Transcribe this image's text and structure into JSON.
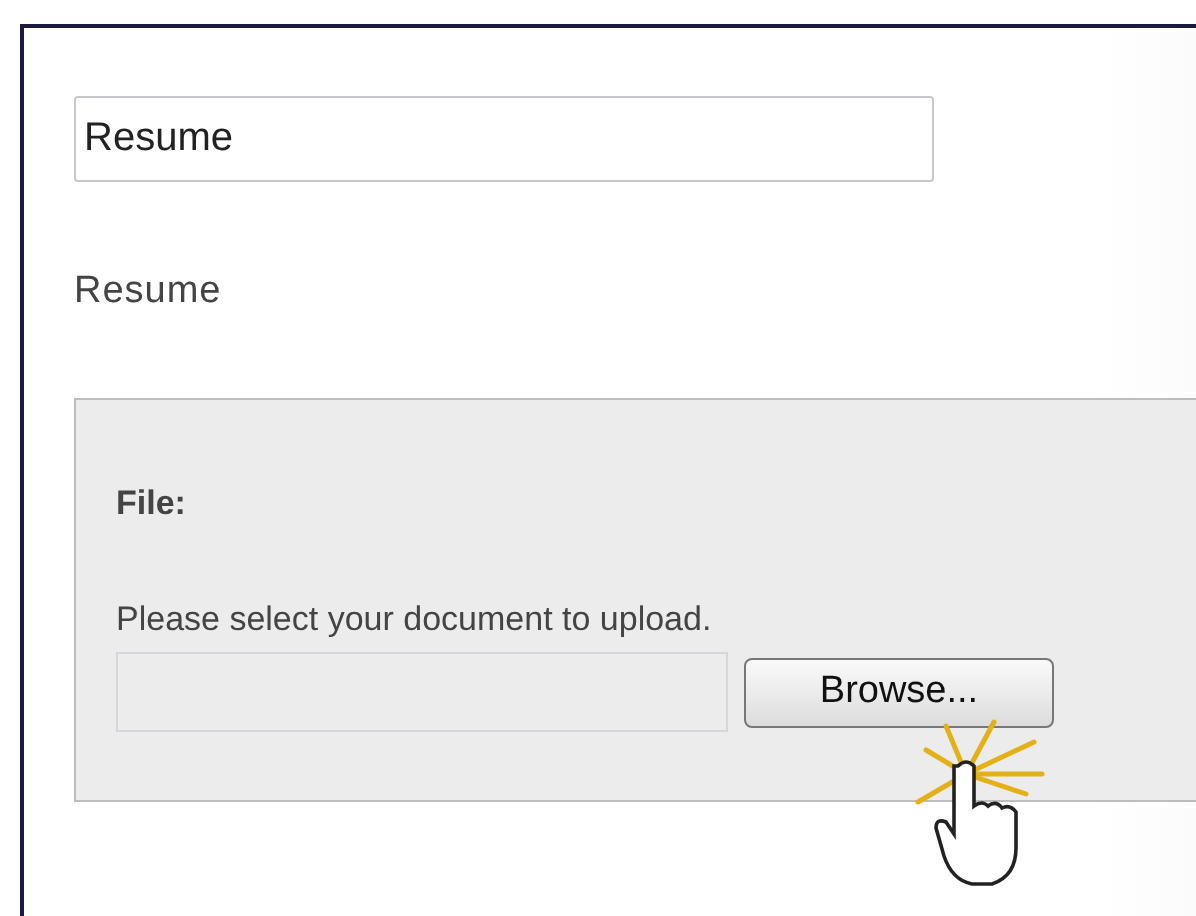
{
  "title_field": {
    "value": "Resume"
  },
  "title_label": "Resume",
  "upload_panel": {
    "heading": "File:",
    "instruction": "Please select your document to upload.",
    "browse_button": "Browse..."
  }
}
